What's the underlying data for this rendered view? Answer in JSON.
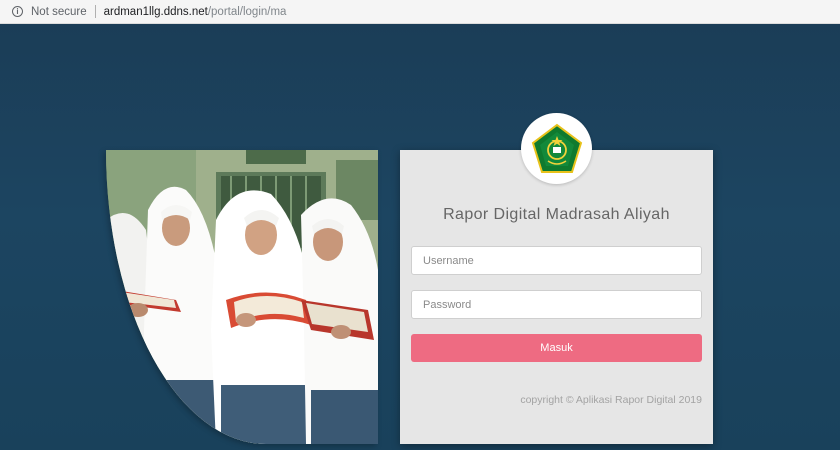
{
  "browser": {
    "security_label": "Not secure",
    "url_host": "ardman1llg.ddns.net",
    "url_path": "/portal/login/ma"
  },
  "login": {
    "title": "Rapor Digital Madrasah Aliyah",
    "username_placeholder": "Username",
    "password_placeholder": "Password",
    "submit_label": "Masuk",
    "copyright": "copyright © Aplikasi Rapor Digital 2019"
  },
  "icons": {
    "info": "info-icon",
    "logo": "kemenag-logo-icon"
  },
  "colors": {
    "background": "#1e3b55",
    "button": "#ee6b82",
    "card": "#e6e6e6"
  }
}
